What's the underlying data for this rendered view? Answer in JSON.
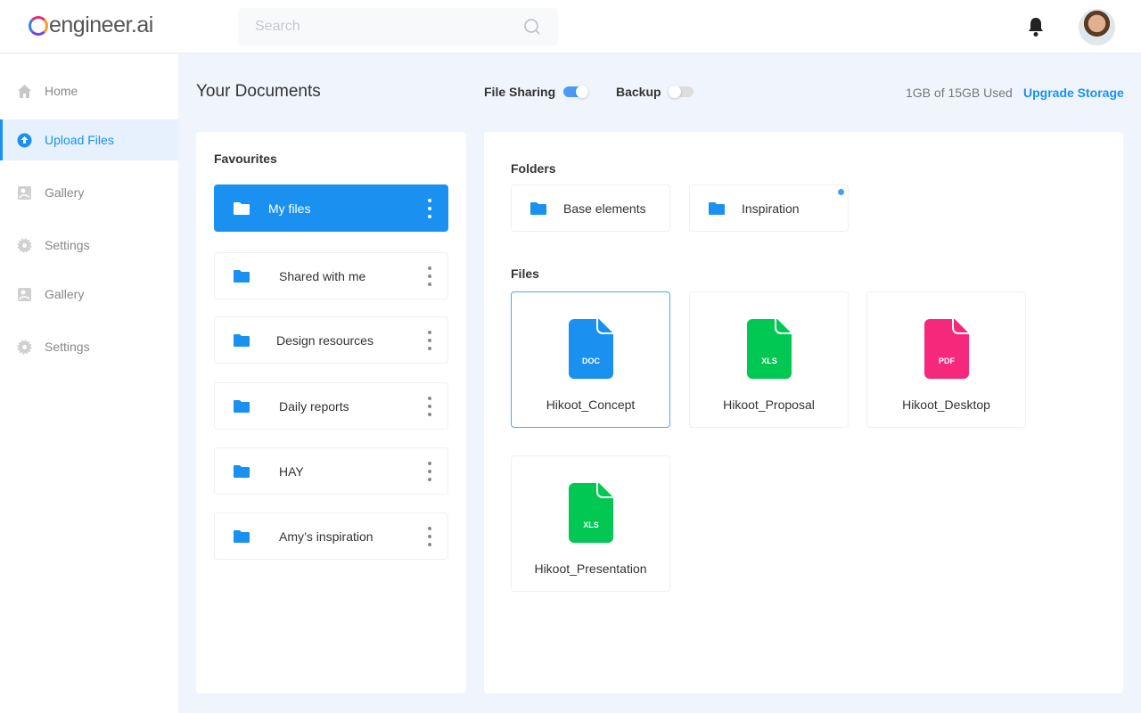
{
  "header": {
    "logo_text": "engineer.ai",
    "search_placeholder": "Search"
  },
  "sidebar": {
    "items": [
      {
        "label": "Home",
        "icon": "home-icon"
      },
      {
        "label": "Upload Files",
        "icon": "upload-icon",
        "active": true
      },
      {
        "label": "Gallery",
        "icon": "gallery-icon"
      },
      {
        "label": "Settings",
        "icon": "gear-icon"
      },
      {
        "label": "Gallery",
        "icon": "gallery-icon"
      },
      {
        "label": "Settings",
        "icon": "gear-icon"
      }
    ]
  },
  "toolbar": {
    "title": "Your Documents",
    "file_sharing_label": "File Sharing",
    "file_sharing_on": true,
    "backup_label": "Backup",
    "backup_on": false,
    "usage": "1GB of 15GB Used",
    "upgrade_label": "Upgrade Storage"
  },
  "favourites": {
    "title": "Favourites",
    "items": [
      "My files",
      "Shared with me",
      "Design resources",
      "Daily reports",
      "HAY",
      "Amy’s inspiration"
    ]
  },
  "folders": {
    "title": "Folders",
    "items": [
      "Base elements",
      "Inspiration"
    ]
  },
  "files": {
    "title": "Files",
    "items": [
      {
        "name": "Hikoot_Concept",
        "type": "DOC",
        "color": "#1a91f0"
      },
      {
        "name": "Hikoot_Proposal",
        "type": "XLS",
        "color": "#00c853"
      },
      {
        "name": "Hikoot_Desktop",
        "type": "PDF",
        "color": "#f5287c"
      },
      {
        "name": "Hikoot_Presentation",
        "type": "XLS",
        "color": "#00c853"
      }
    ]
  },
  "colors": {
    "accent": "#1a91f0",
    "background": "#f0f5fd"
  }
}
